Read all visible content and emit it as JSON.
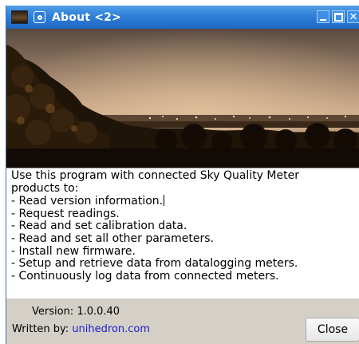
{
  "window": {
    "title": "About <2>",
    "controls": {
      "minimize_icon": "minimize-icon",
      "maximize_icon": "maximize-icon",
      "close_label": "✕"
    }
  },
  "photo": {
    "description_icon": "night-city-photo"
  },
  "about_text": {
    "lines": [
      "Use this program with connected Sky Quality Meter",
      "products to:",
      "- Read version information.",
      "- Request readings.",
      "- Read and set calibration data.",
      "- Read and set all other parameters.",
      "- Install new firmware.",
      "- Setup and retrieve data from datalogging meters.",
      "- Continuously log data from connected meters."
    ]
  },
  "footer": {
    "version_text": "Version: 1.0.0.40",
    "written_by_label": "Written by:",
    "link_text": "unihedron.com",
    "close_label": "Close"
  },
  "colors": {
    "titlebar": "#2f7fd8",
    "dialog_bg": "#d4d0c8",
    "link": "#1d1dcc"
  }
}
